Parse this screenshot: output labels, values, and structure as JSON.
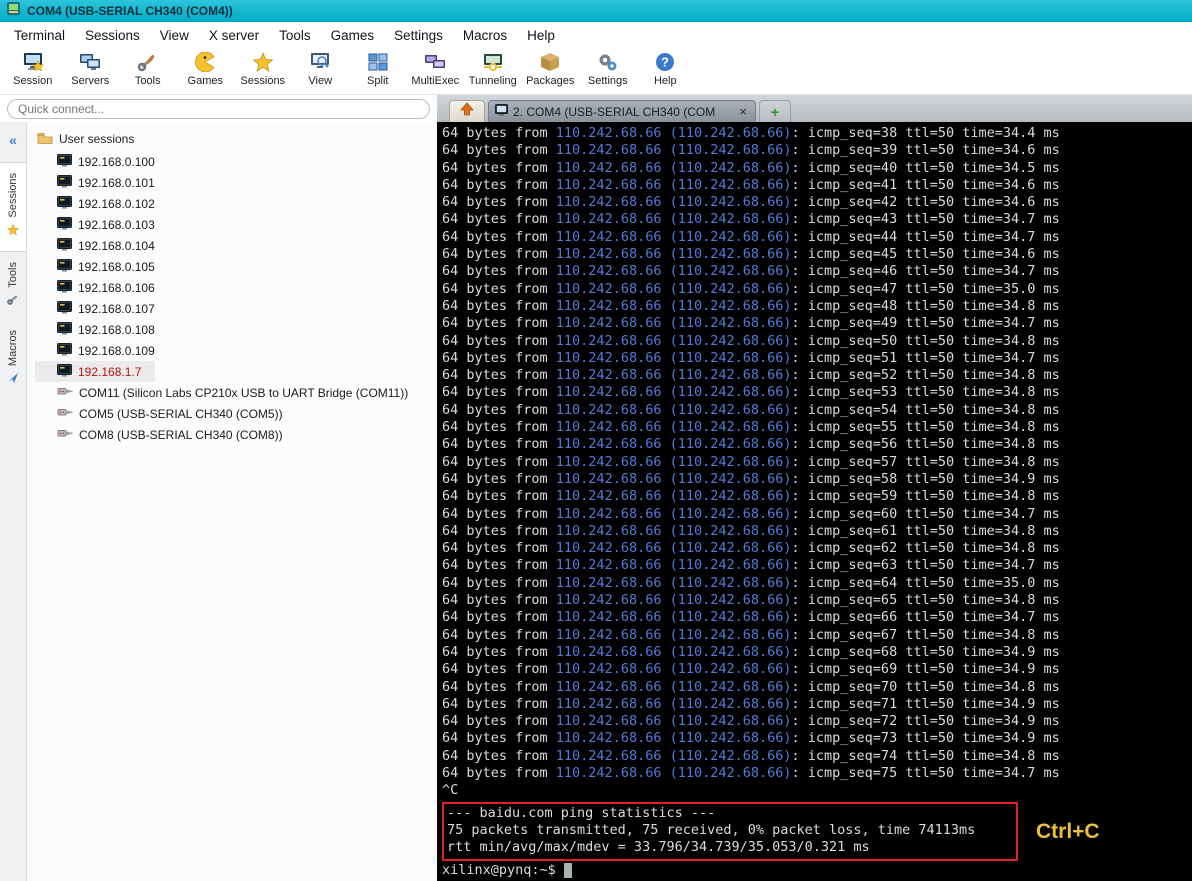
{
  "window": {
    "title": "COM4  (USB-SERIAL CH340 (COM4))"
  },
  "menu": {
    "items": [
      "Terminal",
      "Sessions",
      "View",
      "X server",
      "Tools",
      "Games",
      "Settings",
      "Macros",
      "Help"
    ]
  },
  "toolbar": {
    "items": [
      "Session",
      "Servers",
      "Tools",
      "Games",
      "Sessions",
      "View",
      "Split",
      "MultiExec",
      "Tunneling",
      "Packages",
      "Settings",
      "Help"
    ]
  },
  "quick_connect": {
    "placeholder": "Quick connect..."
  },
  "tabs": {
    "active_label": "2. COM4  (USB-SERIAL CH340 (COM",
    "close_label": "×",
    "new_tab_label": "+"
  },
  "side_tabs": {
    "collapse_label": "«",
    "items": [
      "Sessions",
      "Tools",
      "Macros"
    ]
  },
  "tree": {
    "root_label": "User sessions",
    "items": [
      {
        "label": "192.168.0.100",
        "type": "host",
        "selected": false
      },
      {
        "label": "192.168.0.101",
        "type": "host",
        "selected": false
      },
      {
        "label": "192.168.0.102",
        "type": "host",
        "selected": false
      },
      {
        "label": "192.168.0.103",
        "type": "host",
        "selected": false
      },
      {
        "label": "192.168.0.104",
        "type": "host",
        "selected": false
      },
      {
        "label": "192.168.0.105",
        "type": "host",
        "selected": false
      },
      {
        "label": "192.168.0.106",
        "type": "host",
        "selected": false
      },
      {
        "label": "192.168.0.107",
        "type": "host",
        "selected": false
      },
      {
        "label": "192.168.0.108",
        "type": "host",
        "selected": false
      },
      {
        "label": "192.168.0.109",
        "type": "host",
        "selected": false
      },
      {
        "label": "192.168.1.7",
        "type": "host",
        "selected": true
      },
      {
        "label": "COM11  (Silicon Labs CP210x USB to UART Bridge (COM11))",
        "type": "serial",
        "selected": false
      },
      {
        "label": "COM5  (USB-SERIAL CH340 (COM5))",
        "type": "serial",
        "selected": false
      },
      {
        "label": "COM8  (USB-SERIAL CH340 (COM8))",
        "type": "serial",
        "selected": false
      }
    ]
  },
  "terminal": {
    "bytes_prefix": "64 bytes from",
    "ip": "110.242.68.66",
    "ping_lines": [
      {
        "tail": "icmp_seq=38 ttl=50 time=34.4 ms"
      },
      {
        "tail": "icmp_seq=39 ttl=50 time=34.6 ms"
      },
      {
        "tail": "icmp_seq=40 ttl=50 time=34.5 ms"
      },
      {
        "tail": "icmp_seq=41 ttl=50 time=34.6 ms"
      },
      {
        "tail": "icmp_seq=42 ttl=50 time=34.6 ms"
      },
      {
        "tail": "icmp_seq=43 ttl=50 time=34.7 ms"
      },
      {
        "tail": "icmp_seq=44 ttl=50 time=34.7 ms"
      },
      {
        "tail": "icmp_seq=45 ttl=50 time=34.6 ms"
      },
      {
        "tail": "icmp_seq=46 ttl=50 time=34.7 ms"
      },
      {
        "tail": "icmp_seq=47 ttl=50 time=35.0 ms"
      },
      {
        "tail": "icmp_seq=48 ttl=50 time=34.8 ms"
      },
      {
        "tail": "icmp_seq=49 ttl=50 time=34.7 ms"
      },
      {
        "tail": "icmp_seq=50 ttl=50 time=34.8 ms"
      },
      {
        "tail": "icmp_seq=51 ttl=50 time=34.7 ms"
      },
      {
        "tail": "icmp_seq=52 ttl=50 time=34.8 ms"
      },
      {
        "tail": "icmp_seq=53 ttl=50 time=34.8 ms"
      },
      {
        "tail": "icmp_seq=54 ttl=50 time=34.8 ms"
      },
      {
        "tail": "icmp_seq=55 ttl=50 time=34.8 ms"
      },
      {
        "tail": "icmp_seq=56 ttl=50 time=34.8 ms"
      },
      {
        "tail": "icmp_seq=57 ttl=50 time=34.8 ms"
      },
      {
        "tail": "icmp_seq=58 ttl=50 time=34.9 ms"
      },
      {
        "tail": "icmp_seq=59 ttl=50 time=34.8 ms"
      },
      {
        "tail": "icmp_seq=60 ttl=50 time=34.7 ms"
      },
      {
        "tail": "icmp_seq=61 ttl=50 time=34.8 ms"
      },
      {
        "tail": "icmp_seq=62 ttl=50 time=34.8 ms"
      },
      {
        "tail": "icmp_seq=63 ttl=50 time=34.7 ms"
      },
      {
        "tail": "icmp_seq=64 ttl=50 time=35.0 ms"
      },
      {
        "tail": "icmp_seq=65 ttl=50 time=34.8 ms"
      },
      {
        "tail": "icmp_seq=66 ttl=50 time=34.7 ms"
      },
      {
        "tail": "icmp_seq=67 ttl=50 time=34.8 ms"
      },
      {
        "tail": "icmp_seq=68 ttl=50 time=34.9 ms"
      },
      {
        "tail": "icmp_seq=69 ttl=50 time=34.9 ms"
      },
      {
        "tail": "icmp_seq=70 ttl=50 time=34.8 ms"
      },
      {
        "tail": "icmp_seq=71 ttl=50 time=34.9 ms"
      },
      {
        "tail": "icmp_seq=72 ttl=50 time=34.9 ms"
      },
      {
        "tail": "icmp_seq=73 ttl=50 time=34.9 ms"
      },
      {
        "tail": "icmp_seq=74 ttl=50 time=34.8 ms"
      },
      {
        "tail": "icmp_seq=75 ttl=50 time=34.7 ms"
      }
    ],
    "interrupt": "^C",
    "stats": [
      "--- baidu.com ping statistics ---",
      "75 packets transmitted, 75 received, 0% packet loss, time 74113ms",
      "rtt min/avg/max/mdev = 33.796/34.739/35.053/0.321 ms"
    ],
    "prompt": "xilinx@pynq:~$",
    "annotation": "Ctrl+C",
    "colors": {
      "ip": "#537bd6",
      "text": "#dcdcdc",
      "annotation_text": "#e9c23c",
      "annotation_box": "#e02222",
      "titlebar": "#00b0ca"
    }
  }
}
